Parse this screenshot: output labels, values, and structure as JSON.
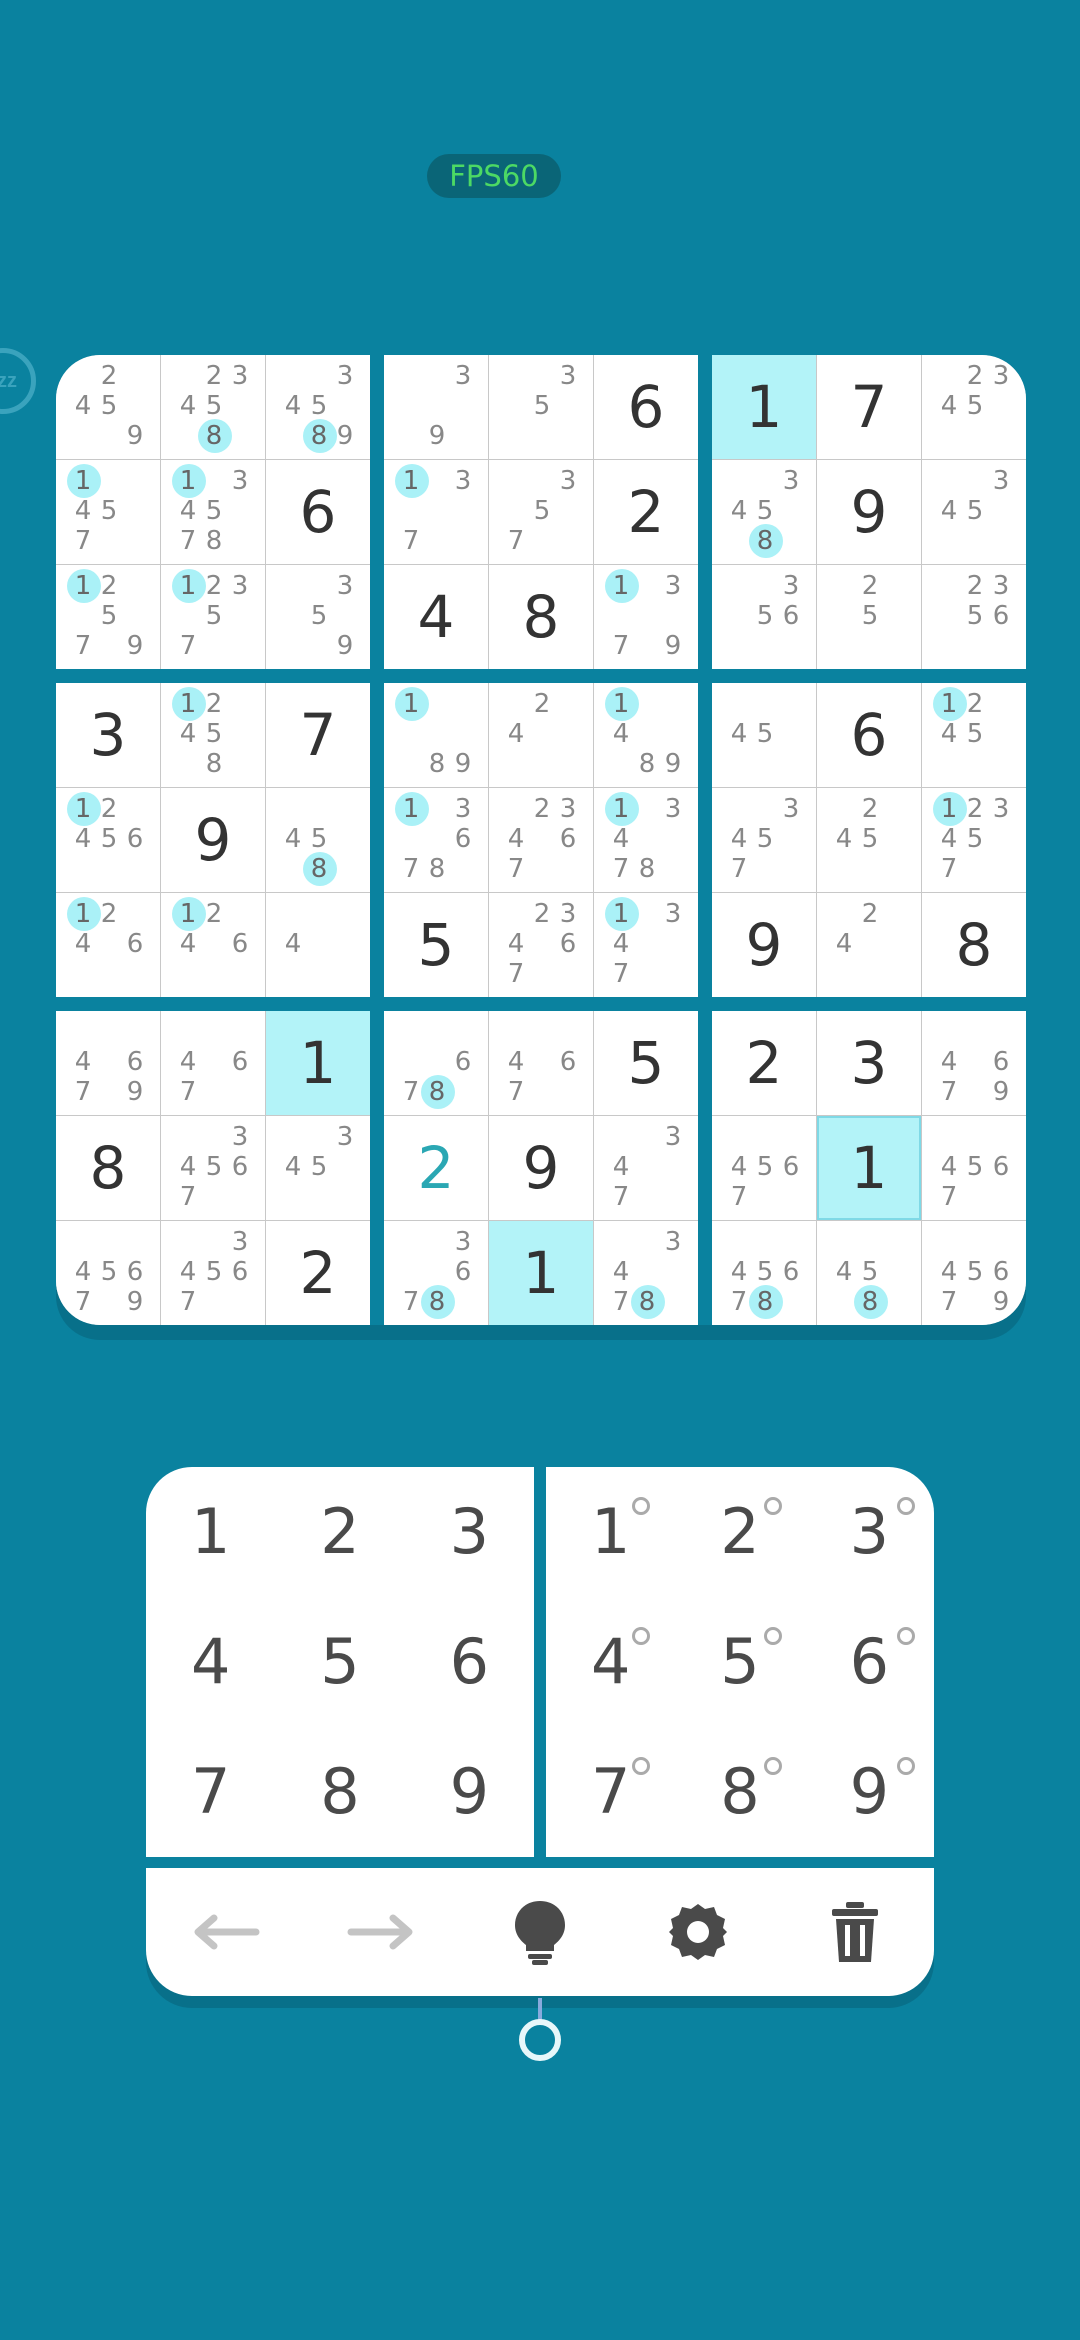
{
  "status": {
    "fps_label": "FPS60",
    "badge_text": "zz"
  },
  "theme": {
    "background": "#0a829f",
    "highlight": "#b3f3f8",
    "note_highlight": "#aaf1f7",
    "user_digit": "#2aa7b3"
  },
  "board": {
    "cells": [
      [
        {
          "n": [
            "",
            "2",
            "",
            "4",
            "5",
            "",
            "",
            "",
            "9"
          ]
        },
        {
          "n": [
            "",
            "2",
            "3",
            "4",
            "5",
            "",
            "",
            "8",
            ""
          ],
          "h": [
            "8"
          ]
        },
        {
          "n": [
            "",
            "",
            "3",
            "4",
            "5",
            "",
            "",
            "8",
            "9"
          ],
          "h": [
            "8"
          ]
        },
        {
          "n": [
            "",
            "",
            "3",
            "",
            "",
            "",
            "",
            "9",
            ""
          ]
        },
        {
          "n": [
            "",
            "",
            "3",
            "",
            "5",
            "",
            "",
            "",
            ""
          ]
        },
        {
          "v": "6"
        },
        {
          "v": "1",
          "hl": true
        },
        {
          "v": "7"
        },
        {
          "n": [
            "",
            "2",
            "3",
            "4",
            "5",
            "",
            "",
            "",
            ""
          ]
        }
      ],
      [
        {
          "n": [
            "1",
            "",
            "",
            "4",
            "5",
            "",
            "7",
            "",
            ""
          ],
          "h": [
            "1"
          ]
        },
        {
          "n": [
            "1",
            "",
            "3",
            "4",
            "5",
            "",
            "7",
            "8",
            ""
          ],
          "h": [
            "1"
          ]
        },
        {
          "v": "6"
        },
        {
          "n": [
            "1",
            "",
            "3",
            "",
            "",
            "",
            "7",
            "",
            ""
          ],
          "h": [
            "1"
          ]
        },
        {
          "n": [
            "",
            "",
            "3",
            "",
            "5",
            "",
            "7",
            "",
            ""
          ]
        },
        {
          "v": "2"
        },
        {
          "n": [
            "",
            "",
            "3",
            "4",
            "5",
            "",
            "",
            "8",
            ""
          ],
          "h": [
            "8"
          ]
        },
        {
          "v": "9"
        },
        {
          "n": [
            "",
            "",
            "3",
            "4",
            "5",
            "",
            "",
            "",
            ""
          ]
        }
      ],
      [
        {
          "n": [
            "1",
            "2",
            "",
            "",
            "5",
            "",
            "7",
            "",
            "9"
          ],
          "h": [
            "1"
          ]
        },
        {
          "n": [
            "1",
            "2",
            "3",
            "",
            "5",
            "",
            "7",
            "",
            ""
          ],
          "h": [
            "1"
          ]
        },
        {
          "n": [
            "",
            "",
            "3",
            "",
            "5",
            "",
            "",
            "",
            "9"
          ]
        },
        {
          "v": "4"
        },
        {
          "v": "8"
        },
        {
          "n": [
            "1",
            "",
            "3",
            "",
            "",
            "",
            "7",
            "",
            "9"
          ],
          "h": [
            "1"
          ]
        },
        {
          "n": [
            "",
            "",
            "3",
            "",
            "5",
            "6",
            "",
            "",
            ""
          ]
        },
        {
          "n": [
            "",
            "2",
            "",
            "",
            "5",
            "",
            "",
            "",
            ""
          ]
        },
        {
          "n": [
            "",
            "2",
            "3",
            "",
            "5",
            "6",
            "",
            "",
            ""
          ]
        }
      ],
      [
        {
          "v": "3"
        },
        {
          "n": [
            "1",
            "2",
            "",
            "4",
            "5",
            "",
            "",
            "8",
            ""
          ],
          "h": [
            "1"
          ]
        },
        {
          "v": "7"
        },
        {
          "n": [
            "1",
            "",
            "",
            "",
            "",
            "",
            "",
            "8",
            "9"
          ],
          "h": [
            "1"
          ]
        },
        {
          "n": [
            "",
            "2",
            "",
            "4",
            "",
            "",
            "",
            "",
            ""
          ]
        },
        {
          "n": [
            "1",
            "",
            "",
            "4",
            "",
            "",
            "",
            "8",
            "9"
          ],
          "h": [
            "1"
          ]
        },
        {
          "n": [
            "",
            "",
            "",
            "4",
            "5",
            "",
            "",
            "",
            ""
          ]
        },
        {
          "v": "6"
        },
        {
          "n": [
            "1",
            "2",
            "",
            "4",
            "5",
            "",
            "",
            "",
            ""
          ],
          "h": [
            "1"
          ]
        }
      ],
      [
        {
          "n": [
            "1",
            "2",
            "",
            "4",
            "5",
            "6",
            "",
            "",
            ""
          ],
          "h": [
            "1"
          ]
        },
        {
          "v": "9"
        },
        {
          "n": [
            "",
            "",
            "",
            "4",
            "5",
            "",
            "",
            "8",
            ""
          ],
          "h": [
            "8"
          ]
        },
        {
          "n": [
            "1",
            "",
            "3",
            "",
            "",
            "6",
            "7",
            "8",
            ""
          ],
          "h": [
            "1"
          ]
        },
        {
          "n": [
            "",
            "2",
            "3",
            "4",
            "",
            "6",
            "7",
            "",
            ""
          ]
        },
        {
          "n": [
            "1",
            "",
            "3",
            "4",
            "",
            "",
            "7",
            "8",
            ""
          ],
          "h": [
            "1"
          ]
        },
        {
          "n": [
            "",
            "",
            "3",
            "4",
            "5",
            "",
            "7",
            "",
            ""
          ]
        },
        {
          "n": [
            "",
            "2",
            "",
            "4",
            "5",
            "",
            "",
            "",
            ""
          ]
        },
        {
          "n": [
            "1",
            "2",
            "3",
            "4",
            "5",
            "",
            "7",
            "",
            ""
          ],
          "h": [
            "1"
          ]
        }
      ],
      [
        {
          "n": [
            "1",
            "2",
            "",
            "4",
            "",
            "6",
            "",
            "",
            ""
          ],
          "h": [
            "1"
          ]
        },
        {
          "n": [
            "1",
            "2",
            "",
            "4",
            "",
            "6",
            "",
            "",
            ""
          ],
          "h": [
            "1"
          ]
        },
        {
          "n": [
            "",
            "",
            "",
            "4",
            "",
            "",
            "",
            "",
            ""
          ]
        },
        {
          "v": "5"
        },
        {
          "n": [
            "",
            "2",
            "3",
            "4",
            "",
            "6",
            "7",
            "",
            ""
          ]
        },
        {
          "n": [
            "1",
            "",
            "3",
            "4",
            "",
            "",
            "7",
            "",
            ""
          ],
          "h": [
            "1"
          ]
        },
        {
          "v": "9"
        },
        {
          "n": [
            "",
            "2",
            "",
            "4",
            "",
            "",
            "",
            "",
            ""
          ]
        },
        {
          "v": "8"
        }
      ],
      [
        {
          "n": [
            "",
            "",
            "",
            "4",
            "",
            "6",
            "7",
            "",
            "9"
          ]
        },
        {
          "n": [
            "",
            "",
            "",
            "4",
            "",
            "6",
            "7",
            "",
            ""
          ]
        },
        {
          "v": "1",
          "hl": true
        },
        {
          "n": [
            "",
            "",
            "",
            "",
            "",
            "6",
            "7",
            "8",
            ""
          ],
          "h": [
            "8"
          ]
        },
        {
          "n": [
            "",
            "",
            "",
            "4",
            "",
            "6",
            "7",
            "",
            ""
          ]
        },
        {
          "v": "5"
        },
        {
          "v": "2"
        },
        {
          "v": "3"
        },
        {
          "n": [
            "",
            "",
            "",
            "4",
            "",
            "6",
            "7",
            "",
            "9"
          ]
        }
      ],
      [
        {
          "v": "8"
        },
        {
          "n": [
            "",
            "",
            "3",
            "4",
            "5",
            "6",
            "7",
            "",
            ""
          ]
        },
        {
          "n": [
            "",
            "",
            "3",
            "4",
            "5",
            "",
            "",
            "",
            ""
          ]
        },
        {
          "v": "2",
          "user": true
        },
        {
          "v": "9"
        },
        {
          "n": [
            "",
            "",
            "3",
            "4",
            "",
            "",
            "7",
            "",
            ""
          ]
        },
        {
          "n": [
            "",
            "",
            "",
            "4",
            "5",
            "6",
            "7",
            "",
            ""
          ]
        },
        {
          "v": "1",
          "hl": true,
          "sel": true
        },
        {
          "n": [
            "",
            "",
            "",
            "4",
            "5",
            "6",
            "7",
            "",
            ""
          ]
        }
      ],
      [
        {
          "n": [
            "",
            "",
            "",
            "4",
            "5",
            "6",
            "7",
            "",
            "9"
          ]
        },
        {
          "n": [
            "",
            "",
            "3",
            "4",
            "5",
            "6",
            "7",
            "",
            ""
          ]
        },
        {
          "v": "2"
        },
        {
          "n": [
            "",
            "",
            "3",
            "",
            "",
            "6",
            "7",
            "8",
            ""
          ],
          "h": [
            "8"
          ]
        },
        {
          "v": "1",
          "hl": true
        },
        {
          "n": [
            "",
            "",
            "3",
            "4",
            "",
            "",
            "7",
            "8",
            ""
          ],
          "h": [
            "8"
          ]
        },
        {
          "n": [
            "",
            "",
            "",
            "4",
            "5",
            "6",
            "7",
            "8",
            ""
          ],
          "h": [
            "8"
          ]
        },
        {
          "n": [
            "",
            "",
            "",
            "4",
            "5",
            "",
            "",
            "8",
            ""
          ],
          "h": [
            "8"
          ]
        },
        {
          "n": [
            "",
            "",
            "",
            "4",
            "5",
            "6",
            "7",
            "",
            "9"
          ]
        }
      ]
    ]
  },
  "number_pad": {
    "digits": [
      "1",
      "2",
      "3",
      "4",
      "5",
      "6",
      "7",
      "8",
      "9"
    ]
  },
  "notes_pad": {
    "digits": [
      "1",
      "2",
      "3",
      "4",
      "5",
      "6",
      "7",
      "8",
      "9"
    ]
  },
  "toolbar": {
    "icons": [
      "undo-arrow-icon",
      "redo-arrow-icon",
      "hint-lightbulb-icon",
      "settings-gear-icon",
      "trash-icon"
    ]
  }
}
